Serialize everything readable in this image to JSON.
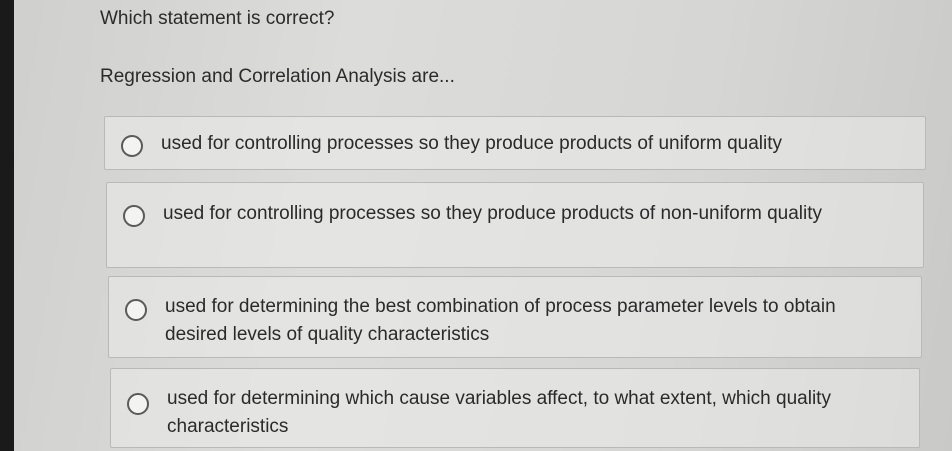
{
  "question": {
    "title": "Which statement is correct?",
    "prompt": "Regression and Correlation Analysis are..."
  },
  "options": [
    {
      "label": "used for controlling processes so they produce products of uniform quality",
      "selected": false
    },
    {
      "label": "used for controlling processes so they produce products of non-uniform quality",
      "selected": false
    },
    {
      "label": "used for determining the best combination of process parameter levels to obtain desired levels of quality characteristics",
      "selected": false
    },
    {
      "label": "used for determining which cause variables affect, to what extent, which quality characteristics",
      "selected": false
    }
  ]
}
